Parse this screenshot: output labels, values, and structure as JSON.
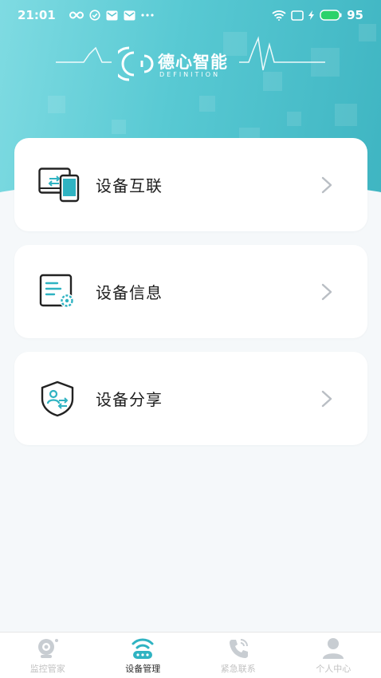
{
  "status_bar": {
    "time": "21:01",
    "battery": "95",
    "icons": [
      "infinity-icon",
      "check-circle-icon",
      "mail-icon",
      "mail-icon",
      "more-dots-icon",
      "wifi-icon",
      "screen-icon",
      "charging-icon",
      "battery-icon"
    ]
  },
  "brand": {
    "name": "德心智能",
    "subtitle": "DEFINITION"
  },
  "menu": [
    {
      "label": "设备互联",
      "icon": "device-connect-icon"
    },
    {
      "label": "设备信息",
      "icon": "device-info-icon"
    },
    {
      "label": "设备分享",
      "icon": "device-share-icon"
    }
  ],
  "nav": {
    "items": [
      {
        "label": "监控管家",
        "icon": "camera-icon",
        "active": false
      },
      {
        "label": "设备管理",
        "icon": "device-manage-icon",
        "active": true
      },
      {
        "label": "紧急联系",
        "icon": "phone-icon",
        "active": false
      },
      {
        "label": "个人中心",
        "icon": "user-icon",
        "active": false
      }
    ]
  },
  "colors": {
    "header_start": "#7fdbe2",
    "header_end": "#3fb5c2",
    "accent": "#2fb3c2",
    "card_bg": "#ffffff",
    "page_bg": "#f5f8fa"
  }
}
